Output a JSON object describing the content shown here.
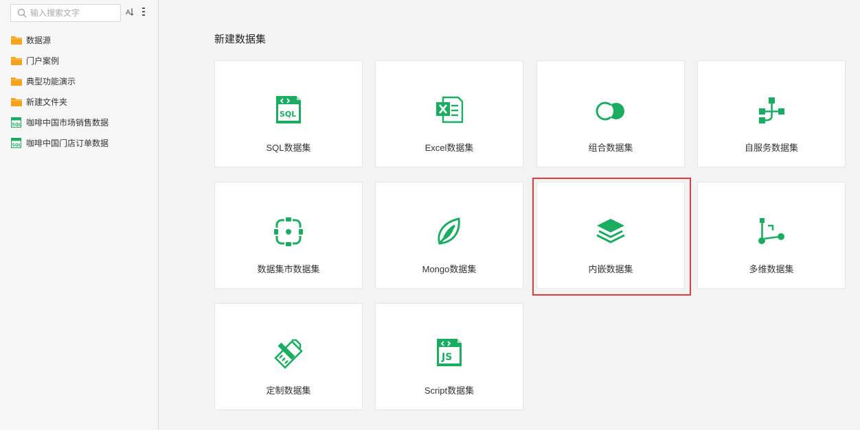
{
  "sidebar": {
    "search": {
      "placeholder": "输入搜索文字",
      "value": ""
    },
    "toolbar": [
      {
        "icon": "sort-icon"
      },
      {
        "icon": "more-vertical-icon"
      }
    ],
    "items": [
      {
        "label": "数据源",
        "icon": "folder-icon"
      },
      {
        "label": "门户案例",
        "icon": "folder-icon"
      },
      {
        "label": "典型功能演示",
        "icon": "folder-icon"
      },
      {
        "label": "新建文件夹",
        "icon": "folder-icon"
      },
      {
        "label": "咖啡中国市场销售数据",
        "icon": "sql-dataset-icon"
      },
      {
        "label": "咖啡中国门店订单数据",
        "icon": "sql-dataset-icon"
      }
    ]
  },
  "main": {
    "title": "新建数据集",
    "cards": [
      {
        "label": "SQL数据集",
        "icon": "sql-icon"
      },
      {
        "label": "Excel数据集",
        "icon": "excel-icon"
      },
      {
        "label": "组合数据集",
        "icon": "combine-icon"
      },
      {
        "label": "自服务数据集",
        "icon": "self-service-icon"
      },
      {
        "label": "数据集市数据集",
        "icon": "datamart-icon"
      },
      {
        "label": "Mongo数据集",
        "icon": "mongo-leaf-icon"
      },
      {
        "label": "内嵌数据集",
        "icon": "layers-icon"
      },
      {
        "label": "多维数据集",
        "icon": "multidimensional-icon"
      },
      {
        "label": "定制数据集",
        "icon": "custom-pencil-icon"
      },
      {
        "label": "Script数据集",
        "icon": "script-js-icon"
      }
    ],
    "highlighted_card": "内嵌数据集"
  },
  "colors": {
    "accent": "#1aad62",
    "folder": "#f7a21b",
    "highlight_border": "#e13b3b",
    "background": "#f3f3f3"
  }
}
